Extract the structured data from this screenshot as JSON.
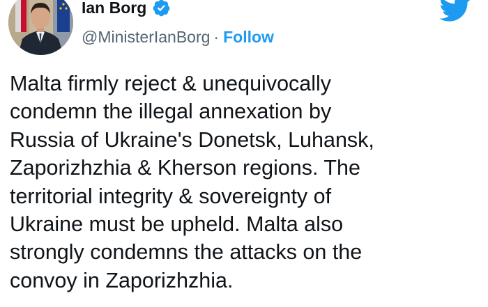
{
  "author": {
    "display_name": "Ian Borg",
    "handle": "@MinisterIanBorg",
    "separator": "·",
    "verified": true,
    "avatar_icon": "profile-photo"
  },
  "actions": {
    "follow_label": "Follow"
  },
  "brand": {
    "logo_icon": "twitter-bird-icon",
    "accent_color": "#1d9bf0"
  },
  "tweet": {
    "text": "Malta firmly reject & unequivocally\ncondemn the illegal annexation by\nRussia of Ukraine's Donetsk, Luhansk,\nZaporizhzhia & Kherson regions. The\nterritorial integrity & sovereignty of\nUkraine must be upheld. Malta also\nstrongly condemns the attacks on the\nconvoy in Zaporizhzhia."
  }
}
